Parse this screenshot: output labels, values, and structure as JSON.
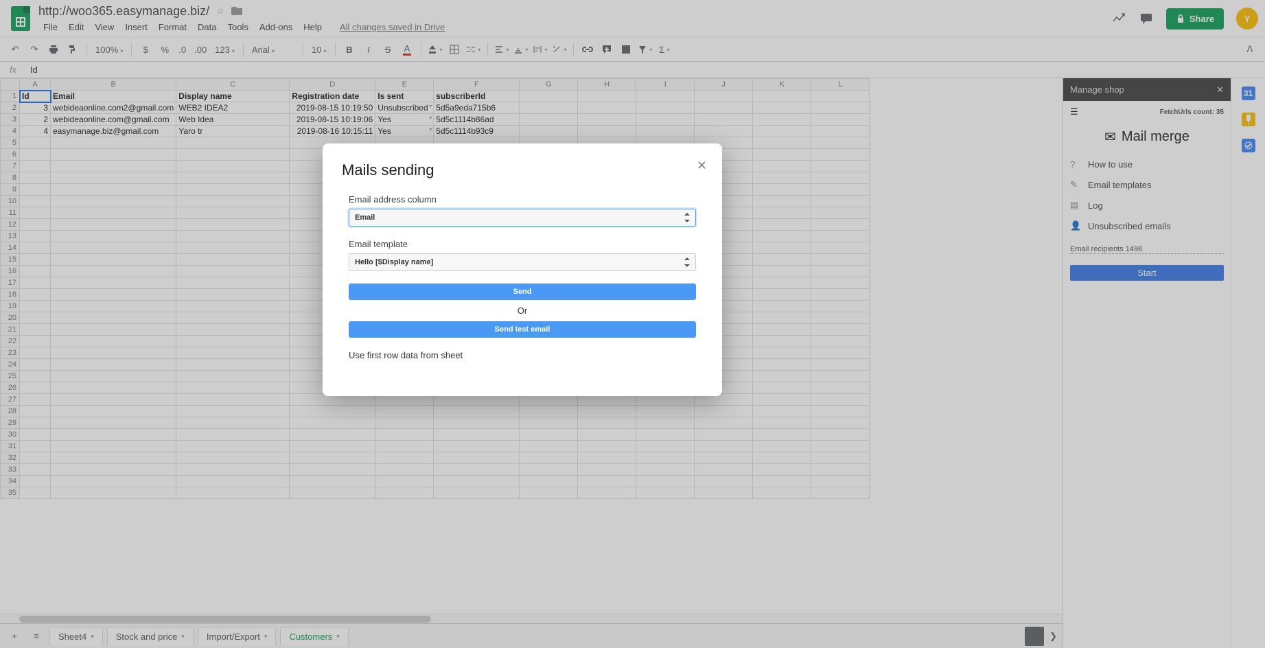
{
  "doc": {
    "title": "http://woo365.easymanage.biz/",
    "save_msg": "All changes saved in Drive"
  },
  "menu": {
    "file": "File",
    "edit": "Edit",
    "view": "View",
    "insert": "Insert",
    "format": "Format",
    "data": "Data",
    "tools": "Tools",
    "addons": "Add-ons",
    "help": "Help"
  },
  "header": {
    "share": "Share",
    "avatar": "Y"
  },
  "toolbar": {
    "zoom": "100%",
    "font": "Arial",
    "size": "10",
    "dollar": "$",
    "percent": "%",
    "dec0": ".0",
    "dec00": ".00",
    "num123": "123"
  },
  "fx": {
    "label": "fx",
    "value": "Id"
  },
  "grid": {
    "cols": [
      "A",
      "B",
      "C",
      "D",
      "E",
      "F",
      "G",
      "H",
      "I",
      "J",
      "K",
      "L"
    ],
    "headers": [
      "Id",
      "Email",
      "Display name",
      "Registration date",
      "Is sent",
      "subscriberId"
    ],
    "rows": [
      {
        "id": "3",
        "email": "webideaonline.com2@gmail.com",
        "name": "WEB2 IDEA2",
        "date": "2019-08-15 10:19:50",
        "sent": "Unsubscribed",
        "sub": "5d5a9eda715b6"
      },
      {
        "id": "2",
        "email": "webideaonline.com@gmail.com",
        "name": "Web Idea",
        "date": "2019-08-15 10:19:06",
        "sent": "Yes",
        "sub": "5d5c1114b86ad"
      },
      {
        "id": "4",
        "email": "easymanage.biz@gmail.com",
        "name": "Yaro tr",
        "date": "2019-08-16 10:15:11",
        "sent": "Yes",
        "sub": "5d5c1114b93c9"
      }
    ]
  },
  "tabs": {
    "add": "+",
    "menu": "≡",
    "t1": "Sheet4",
    "t2": "Stock and price",
    "t3": "Import/Export",
    "t4": "Customers"
  },
  "side": {
    "title": "Manage shop",
    "fetch_label": "FetchUrls count:",
    "fetch_count": "35",
    "mail_title": "Mail merge",
    "how": "How to use",
    "templates": "Email templates",
    "log": "Log",
    "unsub": "Unsubscribed emails",
    "recipients_label": "Email recipients",
    "recipients_count": "1498",
    "start": "Start"
  },
  "modal": {
    "title": "Mails sending",
    "lbl1": "Email address column",
    "sel1": "Email",
    "lbl2": "Email template",
    "sel2": "Hello [$Display name]",
    "send": "Send",
    "or": "Or",
    "send_test": "Send test email",
    "note": "Use first row data from sheet"
  }
}
